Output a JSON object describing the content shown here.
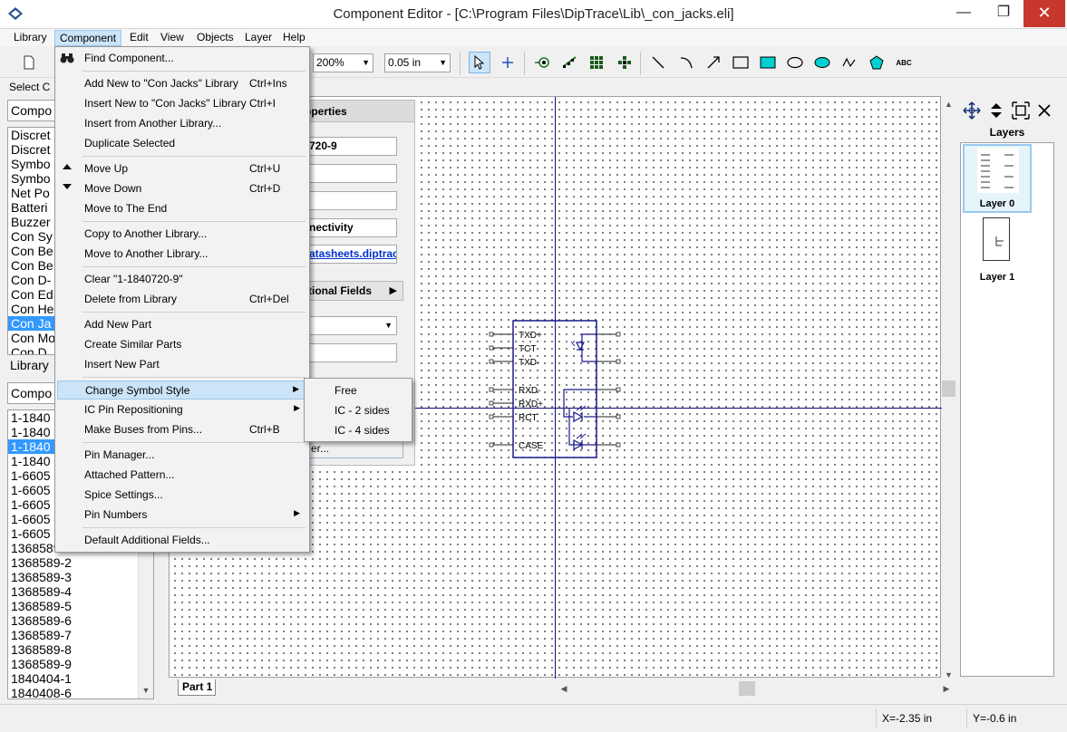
{
  "window": {
    "title": "Component Editor - [C:\\Program Files\\DipTrace\\Lib\\_con_jacks.eli]",
    "minimize": "—",
    "maximize": "❐",
    "close": "✕"
  },
  "menubar": [
    "Library",
    "Component",
    "Edit",
    "View",
    "Objects",
    "Layer",
    "Help"
  ],
  "toolbar": {
    "zoom": "200%",
    "grid": "0.05 in",
    "text_tool": "ABC"
  },
  "left_panel": {
    "select_label": "Select C",
    "category_combo": "Compo",
    "categories": [
      "Discret",
      "Discret",
      "Symbo",
      "Symbo",
      "Net Po",
      "Batteri",
      "Buzzer",
      "Con Sy",
      "Con Be",
      "Con Be",
      "Con D-",
      "Con Ed",
      "Con He",
      "Con Ja",
      "Con Mo",
      "Con D"
    ],
    "selected_category_index": 13,
    "library_combo": "Library",
    "component_combo": "Compo",
    "components": [
      "1-1840",
      "1-1840",
      "1-1840",
      "1-1840",
      "1-6605",
      "1-6605",
      "1-6605",
      "1-6605",
      "1-6605",
      "1368589-1",
      "1368589-2",
      "1368589-3",
      "1368589-4",
      "1368589-5",
      "1368589-6",
      "1368589-7",
      "1368589-8",
      "1368589-9",
      "1840404-1",
      "1840408-6"
    ],
    "selected_component_index": 2
  },
  "properties_panel": {
    "header": "operties",
    "fields": [
      "720-9",
      "",
      "",
      "nectivity",
      "atasheets.diptrac"
    ],
    "additional_fields": "tional Fields",
    "combo": "",
    "field_after": "",
    "bottom_button": "er..."
  },
  "component_menu": {
    "items": [
      {
        "label": "Find Component...",
        "shortcut": "",
        "icon": "binoculars-icon"
      },
      {
        "label": "Add New to \"Con Jacks\" Library",
        "shortcut": "Ctrl+Ins"
      },
      {
        "label": "Insert New to \"Con Jacks\" Library",
        "shortcut": "Ctrl+I"
      },
      {
        "label": "Insert from Another Library...",
        "shortcut": ""
      },
      {
        "label": "Duplicate Selected",
        "shortcut": ""
      },
      {
        "label": "Move Up",
        "shortcut": "Ctrl+U",
        "icon": "arrow-up-icon"
      },
      {
        "label": "Move Down",
        "shortcut": "Ctrl+D",
        "icon": "arrow-down-icon"
      },
      {
        "label": "Move to The End",
        "shortcut": ""
      },
      {
        "label": "Copy to Another Library...",
        "shortcut": ""
      },
      {
        "label": "Move to Another Library...",
        "shortcut": ""
      },
      {
        "label": "Clear \"1-1840720-9\"",
        "shortcut": ""
      },
      {
        "label": "Delete from Library",
        "shortcut": "Ctrl+Del"
      },
      {
        "label": "Add New Part",
        "shortcut": ""
      },
      {
        "label": "Create Similar Parts",
        "shortcut": ""
      },
      {
        "label": "Insert New Part",
        "shortcut": ""
      },
      {
        "label": "Change Symbol Style",
        "shortcut": "",
        "submenu": true
      },
      {
        "label": "IC Pin Repositioning",
        "shortcut": "",
        "submenu": true
      },
      {
        "label": "Make Buses from Pins...",
        "shortcut": "Ctrl+B"
      },
      {
        "label": "Pin Manager...",
        "shortcut": ""
      },
      {
        "label": "Attached Pattern...",
        "shortcut": ""
      },
      {
        "label": "Spice Settings...",
        "shortcut": ""
      },
      {
        "label": "Pin Numbers",
        "shortcut": "",
        "submenu": true
      },
      {
        "label": "Default Additional Fields...",
        "shortcut": ""
      }
    ],
    "hover_index": 15
  },
  "symbol_style_submenu": [
    "Free",
    "IC - 2 sides",
    "IC - 4 sides"
  ],
  "symbol": {
    "pins": [
      "TXD+",
      "TCT",
      "TXD-",
      "RXD-",
      "RXD+",
      "RCT",
      "CASE"
    ]
  },
  "part_tab": "Part 1",
  "layers_panel": {
    "title": "Layers",
    "layers": [
      "Layer 0",
      "Layer 1"
    ],
    "selected": 0
  },
  "status": {
    "x": "X=-2.35 in",
    "y": "Y=-0.6 in"
  },
  "colors": {
    "accent": "#3399ff",
    "menu_hover": "#cce4f7",
    "axis": "#10107a",
    "symbol": "#1a1a8c"
  }
}
